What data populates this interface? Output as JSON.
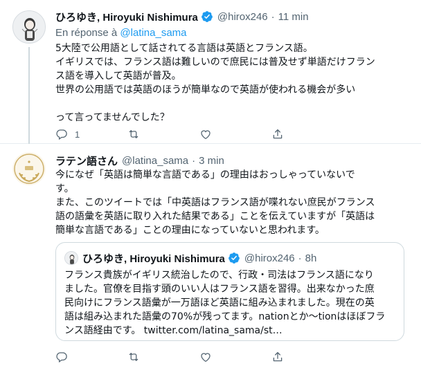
{
  "tweet1": {
    "name": "ひろゆき, Hiroyuki Nishimura",
    "handle": "@hirox246",
    "dot": "·",
    "time": "11 min",
    "reply_prefix": "En réponse à",
    "reply_mention": "@latina_sama",
    "lines": [
      "5大陸で公用語として話されてる言語は英語とフランス語。",
      "イギリスでは、フランス語は難しいので庶民には普及せず単語だけフラン",
      "ス語を導入して英語が普及。",
      "世界の公用語では英語のほうが簡単なので英語が使われる機会が多い",
      "",
      "って言ってませんでした？"
    ],
    "reply_count": "1",
    "retweet_count": "",
    "like_count": ""
  },
  "tweet2": {
    "name": "ラテン語さん",
    "handle": "@latina_sama",
    "dot": "·",
    "time": "3 min",
    "lines": [
      "今になぜ「英語は簡単な言語である」の理由はおっしゃっていないで",
      "す。",
      "また、このツイートでは「中英語はフランス語が喋れない庶民がフランス",
      "語の語彙を英語に取り入れた結果である」ことを伝えていますが「英語は",
      "簡単な言語である」ことの理由になっていないと思われます。"
    ],
    "quote": {
      "name": "ひろゆき, Hiroyuki Nishimura",
      "handle": "@hirox246",
      "dot": "·",
      "time": "8h",
      "lines": [
        "フランス貴族がイギリス統治したので、行政・司法はフランス語になり",
        "ました。官僚を目指す頭のいい人はフランス語を習得。出来なかった庶",
        "民向けにフランス語彙が一万語ほど英語に組み込まれました。現在の英",
        "語は組み込まれた語彙の70%が残ってます。nationとか〜tionはほぼフラ",
        "ンス語経由です。 twitter.com/latina_sama/st…"
      ]
    }
  },
  "icons": {
    "reply": "reply-icon",
    "retweet": "retweet-icon",
    "like": "like-icon",
    "share": "share-icon",
    "verified": "verified-badge-icon"
  },
  "colors": {
    "accent": "#1d9bf0",
    "text": "#0f1419",
    "secondary": "#536471",
    "border": "#cfd9de"
  }
}
